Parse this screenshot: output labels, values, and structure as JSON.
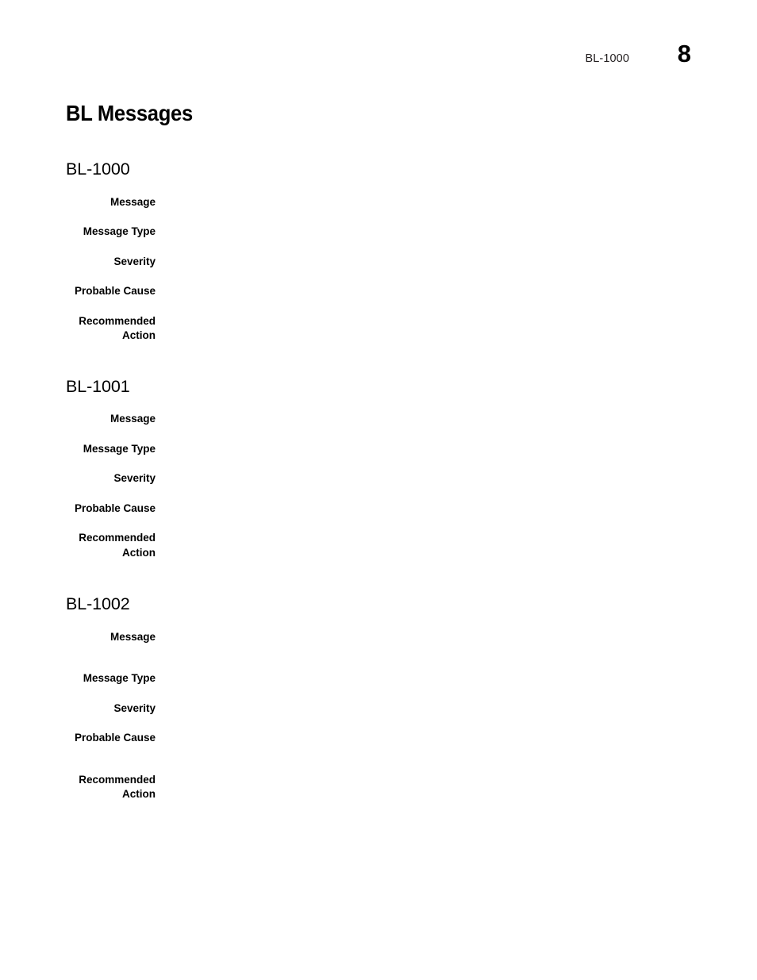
{
  "header": {
    "reference": "BL-1000",
    "page_number": "8"
  },
  "chapter": {
    "title": "BL Messages"
  },
  "field_labels": {
    "message": "Message",
    "message_type": "Message Type",
    "severity": "Severity",
    "probable_cause": "Probable Cause",
    "recommended_action": "Recommended\nAction"
  },
  "sections": [
    {
      "id": "BL-1000",
      "heading": "BL-1000",
      "fields": [
        {
          "label": "Message",
          "value": ""
        },
        {
          "label": "Message Type",
          "value": ""
        },
        {
          "label": "Severity",
          "value": ""
        },
        {
          "label": "Probable Cause",
          "value": ""
        },
        {
          "label": "Recommended\nAction",
          "value": ""
        }
      ]
    },
    {
      "id": "BL-1001",
      "heading": "BL-1001",
      "fields": [
        {
          "label": "Message",
          "value": ""
        },
        {
          "label": "Message Type",
          "value": ""
        },
        {
          "label": "Severity",
          "value": ""
        },
        {
          "label": "Probable Cause",
          "value": ""
        },
        {
          "label": "Recommended\nAction",
          "value": ""
        }
      ]
    },
    {
      "id": "BL-1002",
      "heading": "BL-1002",
      "fields": [
        {
          "label": "Message",
          "value": ""
        },
        {
          "label": "Message Type",
          "value": ""
        },
        {
          "label": "Severity",
          "value": ""
        },
        {
          "label": "Probable Cause",
          "value": ""
        },
        {
          "label": "Recommended\nAction",
          "value": ""
        }
      ]
    }
  ]
}
